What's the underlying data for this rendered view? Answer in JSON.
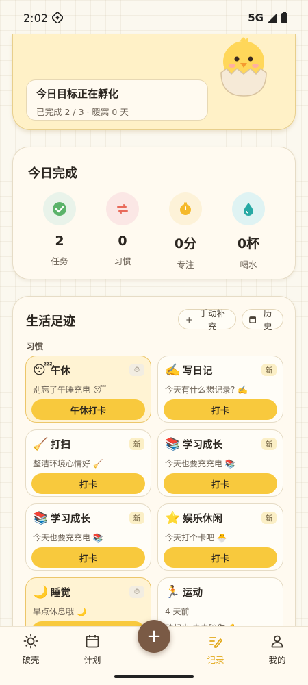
{
  "status": {
    "time": "2:02",
    "network": "5G"
  },
  "hatch": {
    "title": "今日目标正在孵化",
    "subtitle": "已完成 2 / 3 · 暖窝 0 天"
  },
  "today": {
    "title": "今日完成",
    "stats": [
      {
        "value": "2",
        "label": "任务",
        "icon": "check-icon",
        "color": "#e9f3ea"
      },
      {
        "value": "0",
        "label": "习惯",
        "icon": "repeat-icon",
        "color": "#fbe7e5"
      },
      {
        "value": "0分",
        "label": "专注",
        "icon": "stopwatch-icon",
        "color": "#fdf2d8"
      },
      {
        "value": "0杯",
        "label": "喝水",
        "icon": "water-drop-icon",
        "color": "#dff3f3"
      }
    ]
  },
  "life": {
    "title": "生活足迹",
    "manual_btn": "手动补充",
    "history_btn": "历史",
    "section_label": "习惯",
    "habits": [
      {
        "emoji": "😴",
        "name": "午休",
        "badge": "⏱",
        "desc": "别忘了午睡充电 😴",
        "button": "午休打卡"
      },
      {
        "emoji": "✍️",
        "name": "写日记",
        "badge": "新",
        "desc": "今天有什么想记录? ✍️",
        "button": "打卡"
      },
      {
        "emoji": "🧹",
        "name": "打扫",
        "badge": "新",
        "desc": "整洁环境心情好 🧹",
        "button": "打卡"
      },
      {
        "emoji": "📚",
        "name": "学习成长",
        "badge": "新",
        "desc": "今天也要充充电 📚",
        "button": "打卡"
      },
      {
        "emoji": "📚",
        "name": "学习成长",
        "badge": "新",
        "desc": "今天也要充充电 📚",
        "button": "打卡"
      },
      {
        "emoji": "⭐",
        "name": "娱乐休闲",
        "badge": "新",
        "desc": "今天打个卡吧 🐣",
        "button": "打卡"
      },
      {
        "emoji": "🌙",
        "name": "睡觉",
        "badge": "⏱",
        "desc": "早点休息哦 🌙",
        "button": ""
      },
      {
        "emoji": "🏃",
        "name": "运动",
        "badge": "",
        "desc": "4 天前",
        "desc2": "动起来,壳壳陪你 💪",
        "button": ""
      }
    ]
  },
  "nav": {
    "items": [
      {
        "label": "破壳",
        "icon": "sun-icon"
      },
      {
        "label": "计划",
        "icon": "calendar-icon"
      },
      {
        "label": "记录",
        "icon": "edit-icon"
      },
      {
        "label": "我的",
        "icon": "user-icon"
      }
    ],
    "fab": "+",
    "active_color": "#e2a91b"
  }
}
